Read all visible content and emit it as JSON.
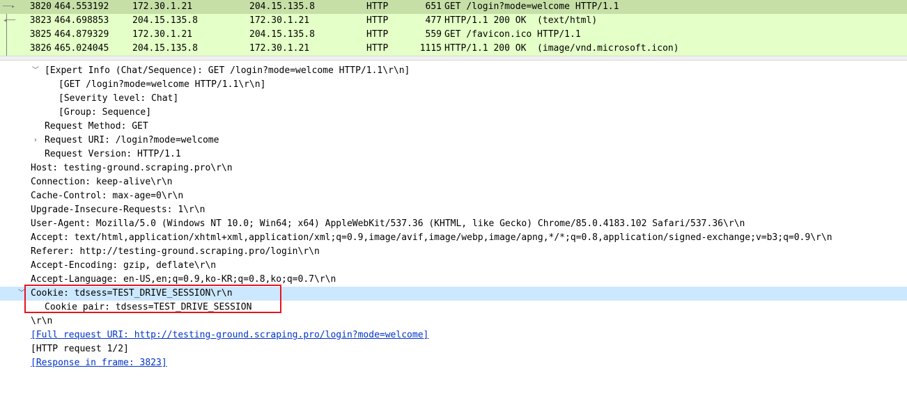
{
  "packet_list": {
    "rows": [
      {
        "no": "3820",
        "time": "464.553192",
        "src": "172.30.1.21",
        "dst": "204.15.135.8",
        "proto": "HTTP",
        "len": "651",
        "info": "GET /login?mode=welcome HTTP/1.1"
      },
      {
        "no": "3823",
        "time": "464.698853",
        "src": "204.15.135.8",
        "dst": "172.30.1.21",
        "proto": "HTTP",
        "len": "477",
        "info": "HTTP/1.1 200 OK  (text/html)"
      },
      {
        "no": "3825",
        "time": "464.879329",
        "src": "172.30.1.21",
        "dst": "204.15.135.8",
        "proto": "HTTP",
        "len": "559",
        "info": "GET /favicon.ico HTTP/1.1"
      },
      {
        "no": "3826",
        "time": "465.024045",
        "src": "204.15.135.8",
        "dst": "172.30.1.21",
        "proto": "HTTP",
        "len": "1115",
        "info": "HTTP/1.1 200 OK  (image/vnd.microsoft.icon)"
      }
    ]
  },
  "details": {
    "expert_info": "[Expert Info (Chat/Sequence): GET /login?mode=welcome HTTP/1.1\\r\\n]",
    "expert_get": "[GET /login?mode=welcome HTTP/1.1\\r\\n]",
    "severity": "[Severity level: Chat]",
    "group": "[Group: Sequence]",
    "method": "Request Method: GET",
    "uri": "Request URI: /login?mode=welcome",
    "version": "Request Version: HTTP/1.1",
    "host": "Host: testing-ground.scraping.pro\\r\\n",
    "connection": "Connection: keep-alive\\r\\n",
    "cache_control": "Cache-Control: max-age=0\\r\\n",
    "upgrade": "Upgrade-Insecure-Requests: 1\\r\\n",
    "user_agent": "User-Agent: Mozilla/5.0 (Windows NT 10.0; Win64; x64) AppleWebKit/537.36 (KHTML, like Gecko) Chrome/85.0.4183.102 Safari/537.36\\r\\n",
    "accept": "Accept: text/html,application/xhtml+xml,application/xml;q=0.9,image/avif,image/webp,image/apng,*/*;q=0.8,application/signed-exchange;v=b3;q=0.9\\r\\n",
    "referer": "Referer: http://testing-ground.scraping.pro/login\\r\\n",
    "accept_encoding": "Accept-Encoding: gzip, deflate\\r\\n",
    "accept_language": "Accept-Language: en-US,en;q=0.9,ko-KR;q=0.8,ko;q=0.7\\r\\n",
    "cookie": "Cookie: tdsess=TEST_DRIVE_SESSION\\r\\n",
    "cookie_pair": "Cookie pair: tdsess=TEST_DRIVE_SESSION",
    "crlf": "\\r\\n",
    "full_uri": "[Full request URI: http://testing-ground.scraping.pro/login?mode=welcome]",
    "http_request": "[HTTP request 1/2]",
    "response_in": "[Response in frame: 3823]"
  },
  "colors": {
    "packet_row_bg": "#e4ffc7",
    "packet_selected_bg": "#c6dfa7",
    "detail_highlight": "#cce8ff",
    "annotation_box": "#e8131b",
    "link": "#0033cc"
  }
}
